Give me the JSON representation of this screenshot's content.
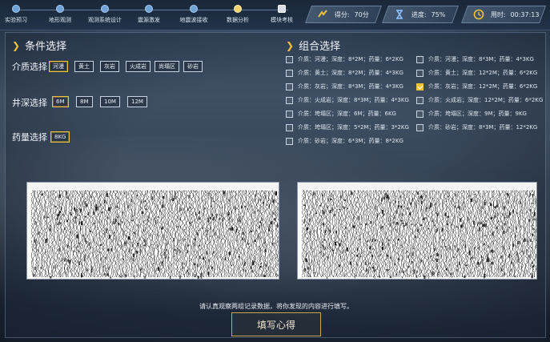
{
  "steps": [
    {
      "label": "实验预习",
      "icon": "step-dot"
    },
    {
      "label": "地形观测",
      "icon": "step-dot"
    },
    {
      "label": "观测系统设计",
      "icon": "step-dot"
    },
    {
      "label": "震源激发",
      "icon": "step-dot"
    },
    {
      "label": "地震波接收",
      "icon": "step-dot"
    },
    {
      "label": "数据分析",
      "icon": "step-dot-active"
    },
    {
      "label": "模块考核",
      "icon": "document-icon"
    }
  ],
  "stats": {
    "score_label": "得分:",
    "score_value": "70分",
    "progress_label": "进度:",
    "progress_value": "75%",
    "time_label": "用时:",
    "time_value": "00:37:13"
  },
  "conditions": {
    "title": "条件选择",
    "medium_label": "介质选择",
    "medium_options": [
      "河漫",
      "黄土",
      "灰岩",
      "火成岩",
      "尚塌区",
      "砂岩"
    ],
    "medium_selected": 0,
    "depth_label": "井深选择",
    "depth_options": [
      "6M",
      "8M",
      "10M",
      "12M"
    ],
    "depth_selected": 0,
    "charge_label": "药量选择",
    "charge_options": [
      "8KG"
    ],
    "charge_selected": 0
  },
  "combos": {
    "title": "组合选择",
    "left": [
      {
        "text": "介质：河漫；深度：8*2M；药量：6*2KG",
        "checked": false
      },
      {
        "text": "介质：黄土；深度：8*2M；药量：4*3KG",
        "checked": false
      },
      {
        "text": "介质：灰岩；深度：8*3M；药量：4*3KG",
        "checked": false
      },
      {
        "text": "介质：火成岩；深度：8*3M；药量：4*3KG",
        "checked": false
      },
      {
        "text": "介质：垮塌区；深度：6M；药量：6KG",
        "checked": false
      },
      {
        "text": "介质：垮塌区；深度：5*2M；药量：3*2KG",
        "checked": false
      },
      {
        "text": "介质：砂岩；深度：6*3M；药量：8*2KG",
        "checked": false
      }
    ],
    "right": [
      {
        "text": "介质：河漫；深度：8*3M；药量：4*3KG",
        "checked": false
      },
      {
        "text": "介质：黄土；深度：12*2M；药量：6*2KG",
        "checked": false
      },
      {
        "text": "介质：灰岩；深度：12*2M；药量：6*2KG",
        "checked": true
      },
      {
        "text": "介质：火成岩；深度：12*2M；药量：6*2KG",
        "checked": false
      },
      {
        "text": "介质：垮塌区；深度：9M；药量：9KG",
        "checked": false
      },
      {
        "text": "介质：砂岩；深度：8*3M；药量：12*2KG",
        "checked": false
      }
    ]
  },
  "hint": "请认真观察两组记录数据，将你发现的内容进行填写。",
  "write_button": "填写心得",
  "colors": {
    "accent": "#f0c23a",
    "step": "#6fa3d8"
  }
}
